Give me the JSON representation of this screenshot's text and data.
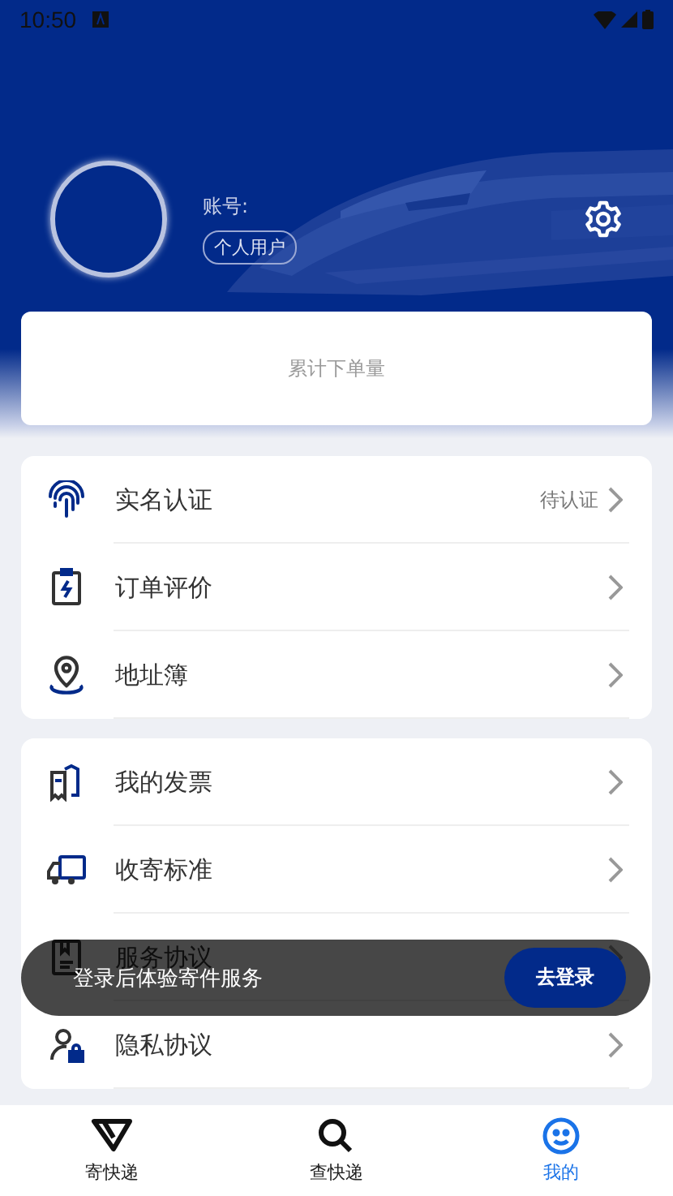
{
  "status_bar": {
    "time": "10:50"
  },
  "profile": {
    "account_label": "账号:",
    "user_type": "个人用户"
  },
  "summary_card": {
    "label": "累计下单量"
  },
  "menu_groups": [
    {
      "items": [
        {
          "label": "实名认证",
          "status": "待认证"
        },
        {
          "label": "订单评价"
        },
        {
          "label": "地址簿"
        }
      ]
    },
    {
      "items": [
        {
          "label": "我的发票"
        },
        {
          "label": "收寄标准"
        },
        {
          "label": "服务协议"
        },
        {
          "label": "隐私协议"
        }
      ]
    }
  ],
  "toast": {
    "message": "登录后体验寄件服务",
    "action": "去登录"
  },
  "tabs": [
    {
      "label": "寄快递",
      "selected": false
    },
    {
      "label": "查快递",
      "selected": false
    },
    {
      "label": "我的",
      "selected": true
    }
  ]
}
